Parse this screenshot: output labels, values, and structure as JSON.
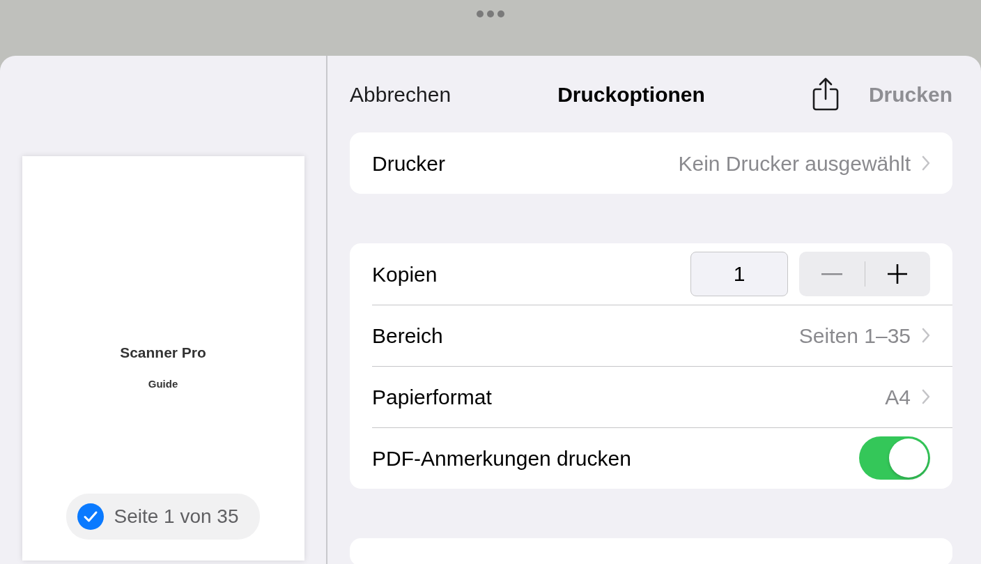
{
  "header": {
    "cancel": "Abbrechen",
    "title": "Druckoptionen",
    "print": "Drucken",
    "print_disabled": true
  },
  "preview": {
    "title": "Scanner Pro",
    "subtitle": "Guide",
    "page_label": "Seite 1 von 35",
    "page_checked": true
  },
  "sections": [
    {
      "rows": [
        {
          "kind": "disclosure",
          "label": "Drucker",
          "value": "Kein Drucker ausgewählt"
        }
      ]
    },
    {
      "rows": [
        {
          "kind": "stepper",
          "label": "Kopien",
          "value": "1"
        },
        {
          "kind": "disclosure",
          "label": "Bereich",
          "value": "Seiten 1–35"
        },
        {
          "kind": "disclosure",
          "label": "Papierformat",
          "value": "A4"
        },
        {
          "kind": "toggle",
          "label": "PDF-Anmerkungen drucken",
          "on": true
        }
      ]
    }
  ]
}
